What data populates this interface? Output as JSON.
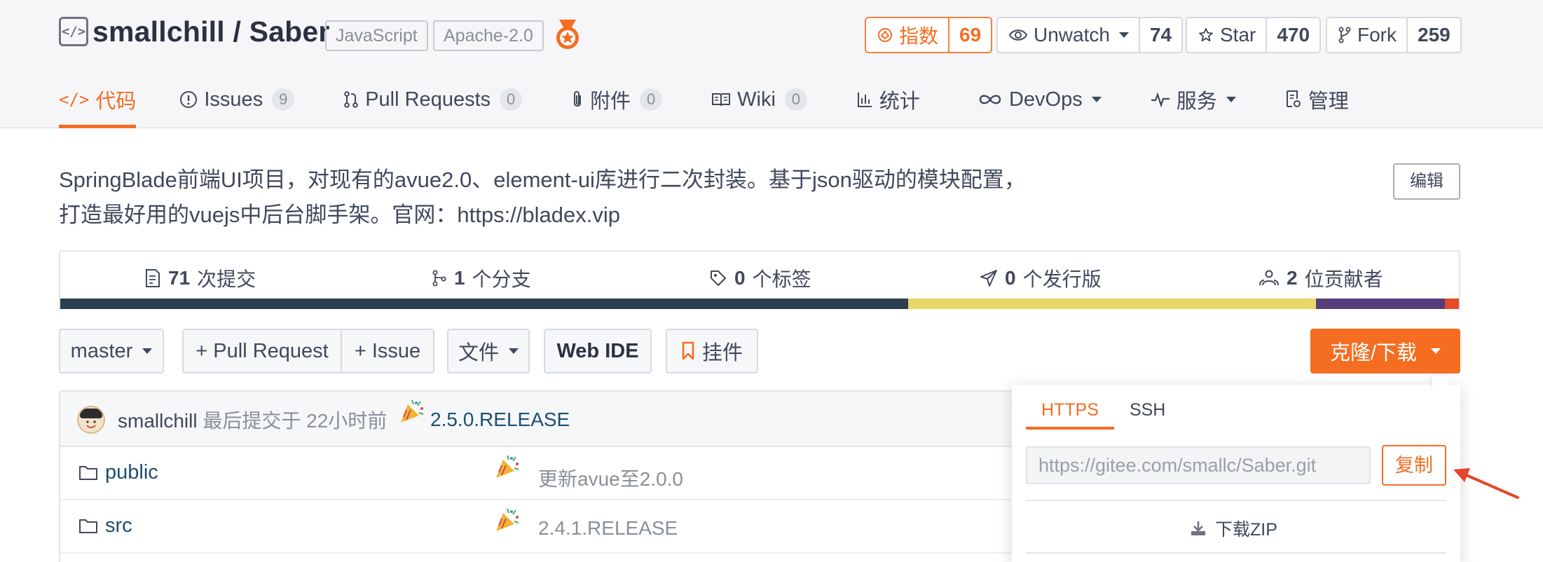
{
  "repo": {
    "owner": "smallchill",
    "name": "Saber",
    "title": "smallchill / Saber",
    "tags": [
      "JavaScript",
      "Apache-2.0"
    ]
  },
  "stats": {
    "index": {
      "label": "指数",
      "count": "69"
    },
    "watch": {
      "label": "Unwatch",
      "count": "74"
    },
    "star": {
      "label": "Star",
      "count": "470"
    },
    "fork": {
      "label": "Fork",
      "count": "259"
    }
  },
  "tabs": [
    {
      "label": "代码",
      "icon": "code-icon"
    },
    {
      "label": "Issues",
      "badge": "9",
      "icon": "issue-icon"
    },
    {
      "label": "Pull Requests",
      "badge": "0",
      "icon": "pull-request-icon"
    },
    {
      "label": "附件",
      "badge": "0",
      "icon": "paperclip-icon"
    },
    {
      "label": "Wiki",
      "badge": "0",
      "icon": "book-icon"
    },
    {
      "label": "统计",
      "icon": "bar-chart-icon"
    },
    {
      "label": "DevOps",
      "icon": "infinity-icon"
    },
    {
      "label": "服务",
      "icon": "pulse-icon"
    },
    {
      "label": "管理",
      "icon": "settings-doc-icon"
    }
  ],
  "description": {
    "line1": "SpringBlade前端UI项目，对现有的avue2.0、element-ui库进行二次封装。基于json驱动的模块配置，",
    "line2": "打造最好用的vuejs中后台脚手架。官网：https://bladex.vip",
    "edit_label": "编辑"
  },
  "summary": {
    "commits": {
      "count": "71",
      "label": "次提交"
    },
    "branches": {
      "count": "1",
      "label": "个分支"
    },
    "tags": {
      "count": "0",
      "label": "个标签"
    },
    "releases": {
      "count": "0",
      "label": "个发行版"
    },
    "contributors": {
      "count": "2",
      "label": "位贡献者"
    }
  },
  "lang_bar_colors": [
    "#2c3e50",
    "#e8d86b",
    "#563d7c",
    "#e34c26"
  ],
  "lang_bar_fractions": [
    0.606,
    0.292,
    0.092,
    0.01
  ],
  "toolbar": {
    "branch": "master",
    "pull_request": "+ Pull Request",
    "issue": "+ Issue",
    "file": "文件",
    "web_ide": "Web IDE",
    "widget": "挂件",
    "clone": "克隆/下载"
  },
  "last_commit": {
    "author": "smallchill",
    "when": "最后提交于 22小时前",
    "message": "2.5.0.RELEASE"
  },
  "files": [
    {
      "name": "public",
      "message": "更新avue至2.0.0"
    },
    {
      "name": "src",
      "message": "2.4.1.RELEASE"
    }
  ],
  "clone": {
    "tabs": [
      "HTTPS",
      "SSH"
    ],
    "url": "https://gitee.com/smallc/Saber.git",
    "copy_label": "复制",
    "zip_label": "下载ZIP"
  },
  "colors": {
    "accent": "#f46d21",
    "link": "#1d4e6e"
  }
}
